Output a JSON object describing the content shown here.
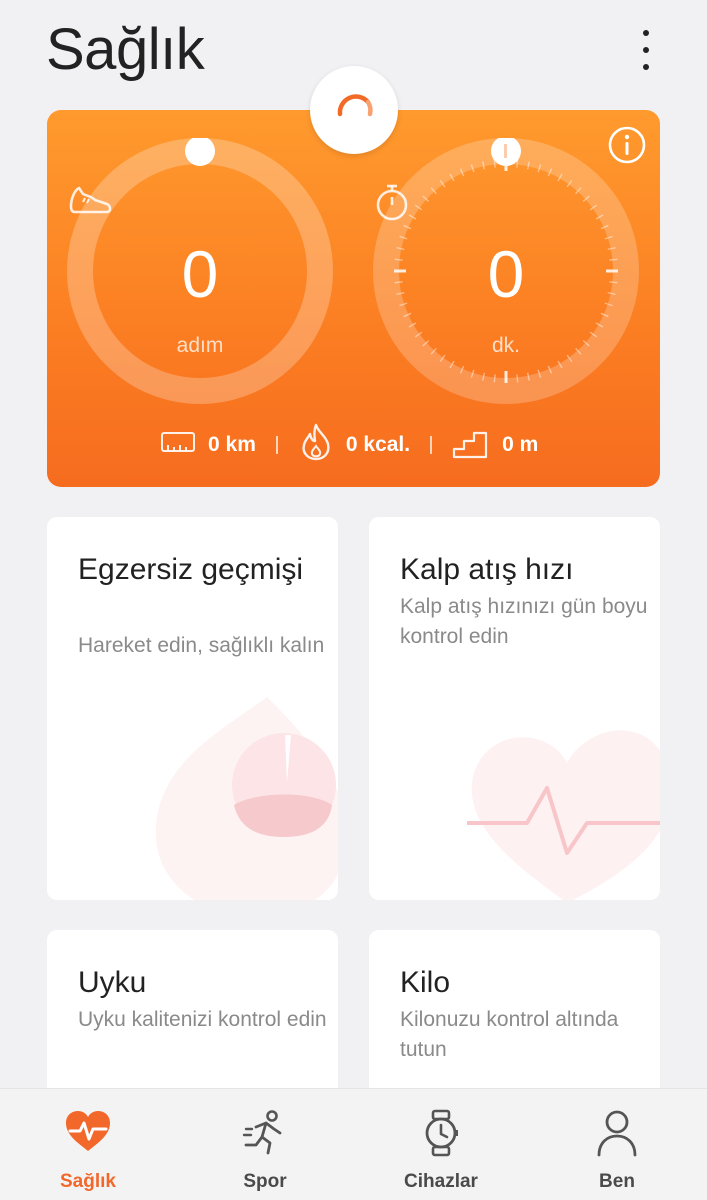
{
  "header": {
    "title": "Sağlık"
  },
  "summary": {
    "steps": {
      "value": "0",
      "unit": "adım"
    },
    "duration": {
      "value": "0",
      "unit": "dk."
    },
    "distance": "0 km",
    "calories": "0 kcal.",
    "elevation": "0 m"
  },
  "cards": [
    {
      "title": "Egzersiz geçmişi",
      "description": "Hareket edin, sağlıklı kalın"
    },
    {
      "title": "Kalp atış hızı",
      "description": "Kalp atış hızınızı gün boyu kontrol edin"
    },
    {
      "title": "Uyku",
      "description": "Uyku kalitenizi kontrol edin"
    },
    {
      "title": "Kilo",
      "description": "Kilonuzu kontrol altında tutun"
    }
  ],
  "nav": {
    "items": [
      {
        "label": "Sağlık",
        "icon": "heart-pulse-icon",
        "active": true
      },
      {
        "label": "Spor",
        "icon": "running-icon",
        "active": false
      },
      {
        "label": "Cihazlar",
        "icon": "watch-icon",
        "active": false
      },
      {
        "label": "Ben",
        "icon": "person-icon",
        "active": false
      }
    ]
  },
  "colors": {
    "accent": "#f2682b",
    "hero_top": "#ff9a2e",
    "hero_bottom": "#f66c1f",
    "background": "#f1f1f3"
  }
}
